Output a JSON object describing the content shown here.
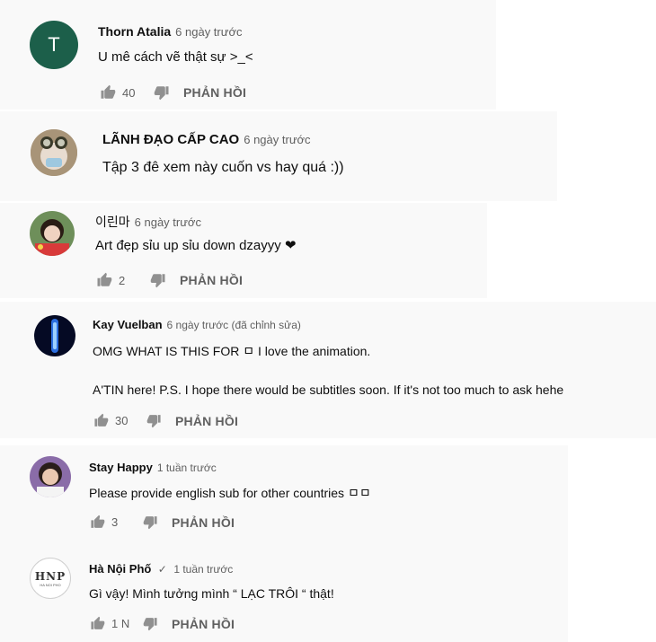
{
  "comments": [
    {
      "author": "Thorn Atalia",
      "time": "6 ngày trước",
      "text": "U mê cách vẽ thật sự >_<",
      "likes": "40",
      "reply": "PHẢN HỒI",
      "avatar_letter": "T",
      "avatar_color": "#1c5f4a"
    },
    {
      "author": "LÃNH ĐẠO CẤP CAO",
      "time": "6 ngày trước",
      "text": "Tập 3 đê xem này cuốn vs hay quá :))"
    },
    {
      "author": "이린마",
      "time": "6 ngày trước",
      "text": "Art đẹp sỉu up sỉu down dzayyy ❤",
      "likes": "2",
      "reply": "PHẢN HỒI"
    },
    {
      "author": "Kay Vuelban",
      "time": "6 ngày trước (đã chỉnh sửa)",
      "text": "OMG WHAT IS THIS FOR ㅁ I love the animation.",
      "text2": "A'TIN here! P.S. I hope there would be subtitles soon. If it's not too much to ask hehe",
      "likes": "30",
      "reply": "PHẢN HỒI"
    },
    {
      "author": "Stay Happy",
      "time": "1 tuần trước",
      "text": "Please  provide english sub for other countries ㅁㅁ",
      "likes": "3",
      "reply": "PHẢN HỒI"
    },
    {
      "author": "Hà Nội Phố",
      "time": "1 tuần trước",
      "verified": "✓",
      "text": "Gì vậy! Mình tưởng mình “ LẠC TRÔI “ thật!",
      "likes": "1 N",
      "reply": "PHẢN HỒI",
      "avatar_text": "HNP",
      "avatar_sub": "HA NOI PHO"
    }
  ],
  "icons": {
    "like": "thumb-up-icon",
    "dislike": "thumb-down-icon",
    "verified": "check-icon"
  }
}
